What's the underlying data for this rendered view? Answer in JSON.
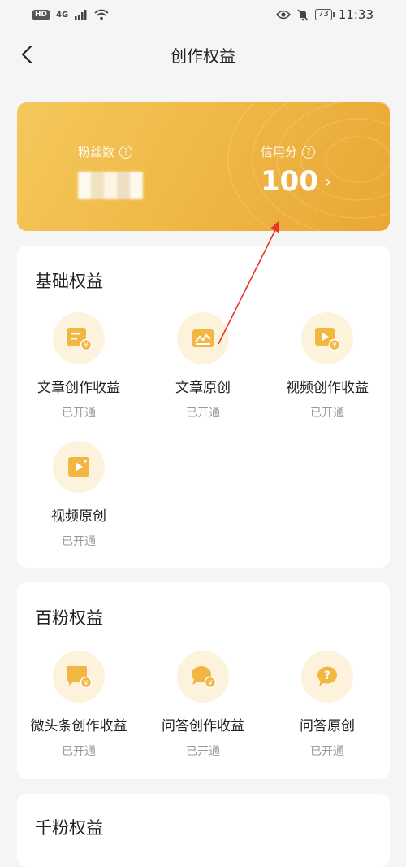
{
  "status_bar": {
    "hd": "HD",
    "signal": "4G",
    "battery": "73",
    "time": "11:33"
  },
  "nav": {
    "title": "创作权益"
  },
  "card": {
    "fans_label": "粉丝数",
    "credit_label": "信用分",
    "credit_value": "100",
    "arrow": "›"
  },
  "sections": {
    "basic": {
      "title": "基础权益",
      "items": [
        {
          "label": "文章创作收益",
          "status": "已开通",
          "icon": "article-income-icon"
        },
        {
          "label": "文章原创",
          "status": "已开通",
          "icon": "article-original-icon"
        },
        {
          "label": "视频创作收益",
          "status": "已开通",
          "icon": "video-income-icon"
        },
        {
          "label": "视频原创",
          "status": "已开通",
          "icon": "video-original-icon"
        }
      ]
    },
    "hundred": {
      "title": "百粉权益",
      "items": [
        {
          "label": "微头条创作收益",
          "status": "已开通",
          "icon": "micro-post-income-icon"
        },
        {
          "label": "问答创作收益",
          "status": "已开通",
          "icon": "qa-income-icon"
        },
        {
          "label": "问答原创",
          "status": "已开通",
          "icon": "qa-original-icon"
        }
      ]
    },
    "thousand": {
      "title": "千粉权益"
    }
  },
  "colors": {
    "gold": "#f0b948",
    "icon_bg": "#fdf3dc",
    "icon_fill": "#f2b642",
    "annotation": "#e8362c"
  }
}
